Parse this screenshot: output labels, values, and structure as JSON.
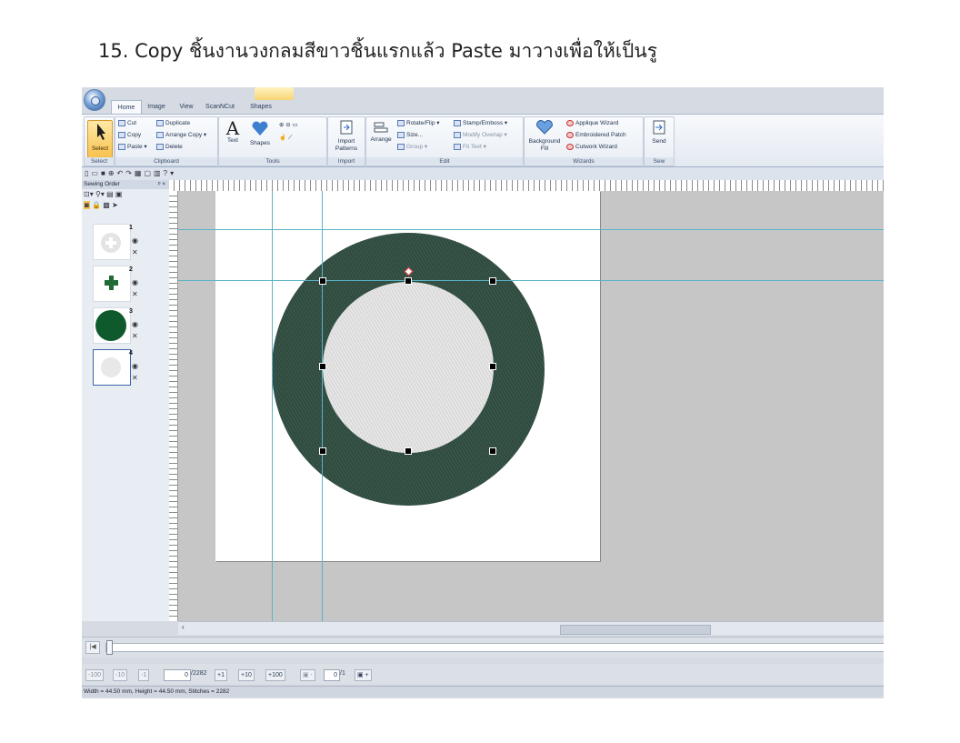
{
  "doc": {
    "title": "15. Copy ชิ้นงานวงกลมสีขาวชิ้นแรกแล้ว Paste  มาวางเพื่อให้เป็นรู"
  },
  "app": {
    "tabs": [
      "Home",
      "Image",
      "View",
      "ScanNCut",
      "Shapes"
    ],
    "active_tab": "Home",
    "groups": {
      "select": {
        "label": "Select",
        "button": "Select"
      },
      "clipboard": {
        "label": "Clipboard",
        "cut": "Cut",
        "copy": "Copy",
        "paste": "Paste",
        "duplicate": "Duplicate",
        "arrange_copy": "Arrange Copy",
        "delete": "Delete"
      },
      "tools": {
        "label": "Tools",
        "text": "Text",
        "shapes": "Shapes"
      },
      "import": {
        "label": "Import",
        "button": "Import Patterns"
      },
      "edit": {
        "label": "Edit",
        "arrange": "Arrange",
        "rotate_flip": "Rotate/Flip",
        "size": "Size...",
        "group": "Group",
        "stamp_emboss": "Stamp/Emboss",
        "modify_overlap": "Modify Overlap",
        "fit_text": "Fit Text"
      },
      "wizards": {
        "label": "Wizards",
        "background_fill": "Background Fill",
        "applique_wizard": "Applique Wizard",
        "embroidered_patch": "Embroidered Patch",
        "cutwork_wizard": "Cutwork Wizard"
      },
      "sew": {
        "label": "Sew",
        "send": "Send"
      }
    },
    "sewing_order": {
      "title": "Sewing Order",
      "pin": "ᵖ ×",
      "items": [
        {
          "number": "1"
        },
        {
          "number": "2"
        },
        {
          "number": "3"
        },
        {
          "number": "4"
        }
      ]
    },
    "stitch_controls": {
      "minus100": "-100",
      "minus10": "-10",
      "minus1": "-1",
      "current": "0",
      "total": "/2282",
      "plus1": "+1",
      "plus10": "+10",
      "plus100": "+100",
      "page_current": "0",
      "page_total": "/1"
    },
    "status": "Width = 44.50 mm, Height = 44.50 mm, Stitches = 2282",
    "colors": {
      "ring": "#2f4a3e",
      "inner": "#e6e6e6",
      "cross": "#1f6b34",
      "circle3": "#0f5a2c",
      "guide": "#5ab3c8"
    }
  }
}
